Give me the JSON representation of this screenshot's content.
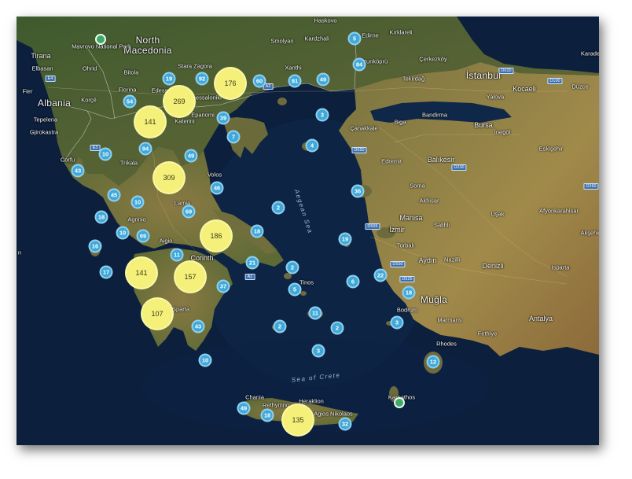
{
  "map": {
    "sea_labels": [
      "Aegean Sea",
      "Sea of Crete"
    ],
    "place_labels": {
      "albania": "Albania",
      "north_macedonia_1": "North",
      "north_macedonia_2": "Macedonia",
      "mavrovo": "Mavrovo National Park",
      "tirana": "Tirana",
      "elbasan": "Elbasan",
      "fier": "Fier",
      "korce": "Korçë",
      "ohrid": "Ohrid",
      "bitola": "Bitola",
      "florina": "Florina",
      "edessa": "Edessa",
      "tepelena": "Tepelena",
      "gjirokastra": "Gjirokastra",
      "corfu": "Corfu",
      "trikala": "Trikala",
      "katerini": "Katerini",
      "thessaloniki": "Thessaloniki",
      "stara_zagora": "Stara Zagora",
      "haskovo": "Haskovo",
      "smolyan": "Smolyan",
      "kardzhali": "Kardzhali",
      "edirne": "Edirne",
      "kirklareli": "Kırklareli",
      "xanthi": "Xanthi",
      "uzunkopru": "Uzunköprü",
      "cerkezkoy": "Çerkezköy",
      "tekirdag": "Tekirdağ",
      "istanbul": "İstanbul",
      "karadeniz": "Karade",
      "duzce": "Düzce",
      "yalova": "Yalova",
      "kocaeli": "Kocaeli",
      "bandirma": "Bandirma",
      "canakkale": "Çanakkale",
      "biga": "Biga",
      "bursa": "Bursa",
      "inegol": "İnegöl",
      "eskisehir": "Eskişehir",
      "edremit": "Edremit",
      "balikesir": "Balıkesir",
      "soma": "Soma",
      "akhisar": "Akhisar",
      "manisa": "Manisa",
      "usak": "Uşak",
      "izmir": "İzmir",
      "salihli": "Salihli",
      "afyonkarahisar": "Afyonkarahisar",
      "aksehir": "Akşehir",
      "torbali": "Torbalı",
      "aydin": "Aydın",
      "nazilli": "Nazilli",
      "denizli": "Denizli",
      "isparta": "Isparta",
      "bodrum": "Bodrum",
      "marmaris": "Marmaris",
      "mugla": "Muğla",
      "fethiye": "Fethiye",
      "antalya": "Antalya",
      "rhodes": "Rhodes",
      "volos": "Volos",
      "lamia": "Lamia",
      "agrinio": "Agrinio",
      "aigio": "Aigio",
      "corinth": "Corinth",
      "sparta": "Sparta",
      "tinos": "Tinos",
      "chania": "Chania",
      "rethymno": "Rethymno",
      "heraklion": "Heraklion",
      "agios_nikolaos": "Agios Nikolaos",
      "karpathos": "Karpathos",
      "epanomi": "Epanomi",
      "n": "n"
    },
    "road_badges": [
      "D100",
      "D020",
      "D650",
      "D230",
      "D260",
      "D565",
      "D550",
      "D525",
      "A2",
      "E4",
      "E3",
      "A1"
    ],
    "clusters": [
      {
        "count": "176"
      },
      {
        "count": "269"
      },
      {
        "count": "141"
      },
      {
        "count": "309"
      },
      {
        "count": "186"
      },
      {
        "count": "141"
      },
      {
        "count": "157"
      },
      {
        "count": "107"
      },
      {
        "count": "135"
      }
    ],
    "small_clusters": [
      "54",
      "19",
      "92",
      "60",
      "81",
      "49",
      "5",
      "84",
      "39",
      "7",
      "3",
      "4",
      "10",
      "94",
      "49",
      "43",
      "46",
      "45",
      "10",
      "69",
      "18",
      "10",
      "69",
      "2",
      "36",
      "16",
      "18",
      "11",
      "21",
      "2",
      "19",
      "17",
      "37",
      "5",
      "6",
      "22",
      "18",
      "2",
      "11",
      "2",
      "3",
      "43",
      "3",
      "10",
      "12",
      "49",
      "18",
      "32"
    ]
  }
}
